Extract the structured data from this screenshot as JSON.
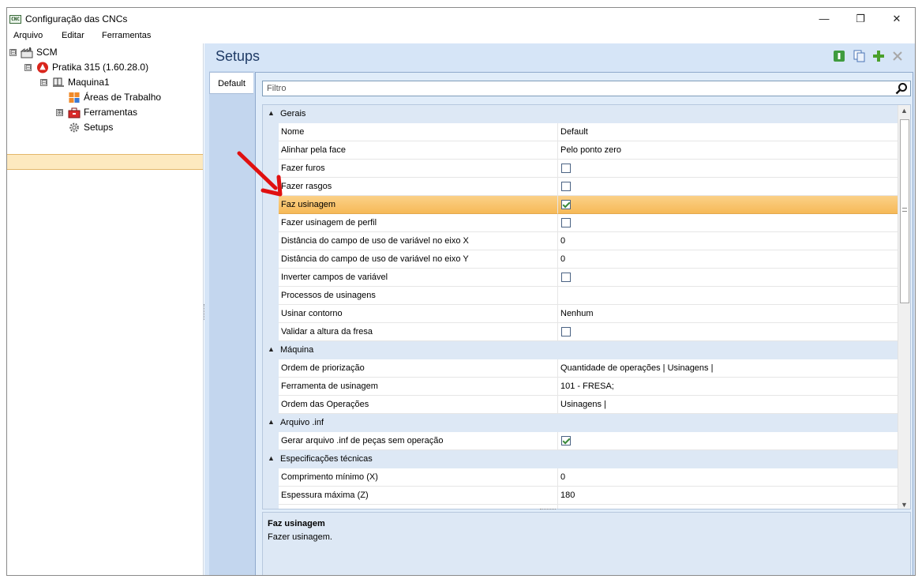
{
  "window": {
    "title": "Configuração das CNCs",
    "app_icon_text": "CNC",
    "minimize": "—",
    "maximize": "❐",
    "close": "✕"
  },
  "menu": [
    "Arquivo",
    "Editar",
    "Ferramentas"
  ],
  "tree": {
    "nodes": [
      {
        "label": "SCM",
        "expander": "⊟",
        "icon": "factory-icon"
      },
      {
        "label": "Pratika 315 (1.60.28.0)",
        "expander": "⊟",
        "icon": "cnc-brand-icon"
      },
      {
        "label": "Maquina1",
        "expander": "⊟",
        "icon": "machine-icon"
      },
      {
        "label": "Áreas de Trabalho",
        "expander": "",
        "icon": "work-areas-icon"
      },
      {
        "label": "Ferramentas",
        "expander": "⊞",
        "icon": "toolbox-icon"
      },
      {
        "label": "Setups",
        "expander": "",
        "icon": "gear-icon",
        "selected": true
      }
    ]
  },
  "panel": {
    "title": "Setups",
    "tab_label": "Default",
    "filter_placeholder": "Filtro"
  },
  "categories": {
    "gerais": "Gerais",
    "maquina": "Máquina",
    "arquivo_inf": "Arquivo .inf",
    "especificacoes": "Especificações técnicas"
  },
  "props": {
    "nome": {
      "name": "Nome",
      "value": "Default"
    },
    "alinhar": {
      "name": "Alinhar pela face",
      "value": "Pelo ponto zero"
    },
    "furos": {
      "name": "Fazer furos",
      "checked": false
    },
    "rasgos": {
      "name": "Fazer rasgos",
      "checked": false
    },
    "usinagem": {
      "name": "Faz usinagem",
      "checked": true
    },
    "usinagem_perfil": {
      "name": "Fazer usinagem de perfil",
      "checked": false
    },
    "dist_x": {
      "name": "Distância do campo de uso de variável no eixo X",
      "value": "0"
    },
    "dist_y": {
      "name": "Distância do campo de uso de variável no eixo Y",
      "value": "0"
    },
    "inverter": {
      "name": "Inverter campos de variável",
      "checked": false
    },
    "processos": {
      "name": "Processos de usinagens",
      "value": ""
    },
    "contorno": {
      "name": "Usinar contorno",
      "value": "Nenhum"
    },
    "validar": {
      "name": "Validar a altura da fresa",
      "checked": false
    },
    "ordem_prio": {
      "name": "Ordem de priorização",
      "value": "Quantidade de operações | Usinagens |"
    },
    "ferramenta": {
      "name": "Ferramenta de usinagem",
      "value": "101 - FRESA;"
    },
    "ordem_op": {
      "name": "Ordem das Operações",
      "value": "Usinagens |"
    },
    "gerar_inf": {
      "name": "Gerar arquivo .inf de peças sem operação",
      "checked": true
    },
    "comprimento": {
      "name": "Comprimento mínimo (X)",
      "value": "0"
    },
    "espessura": {
      "name": "Espessura máxima (Z)",
      "value": "180"
    }
  },
  "help": {
    "title": "Faz usinagem",
    "description": "Fazer usinagem."
  },
  "colors": {
    "selection_highlight": "#f6b957",
    "category_bg": "#dde8f5",
    "panel_bg": "#d6e5f7",
    "annotation_arrow": "#e01010"
  }
}
